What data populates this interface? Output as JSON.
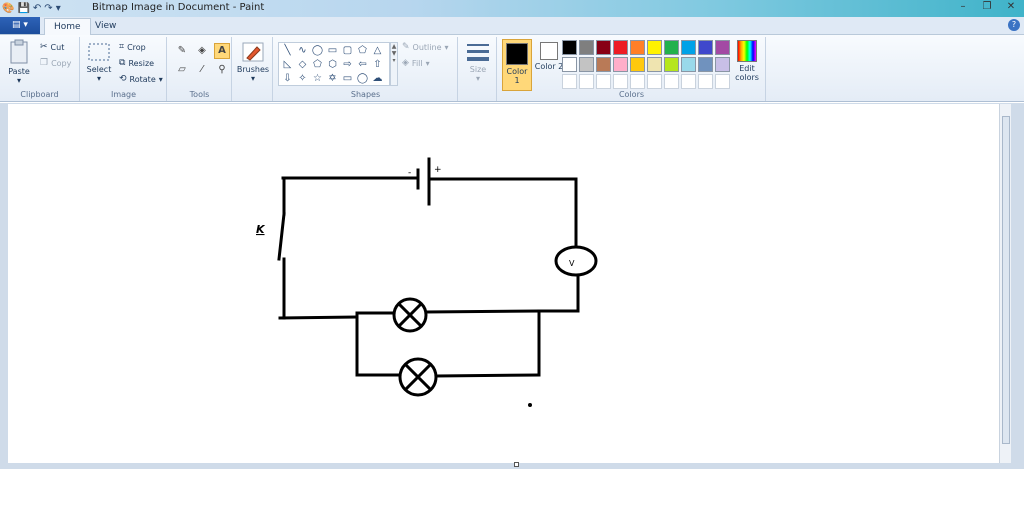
{
  "window": {
    "title": "Bitmap Image in Document - Paint",
    "controls": {
      "minimize": "–",
      "restore": "❐",
      "close": "✕"
    }
  },
  "qat": {
    "save": "💾",
    "undo": "↶",
    "redo": "↷",
    "customize": "▾"
  },
  "menu": {
    "app_button": "▤ ▾",
    "help": "?"
  },
  "tabs": [
    {
      "label": "Home",
      "active": true
    },
    {
      "label": "View",
      "active": false
    }
  ],
  "ribbon": {
    "clipboard": {
      "label": "Clipboard",
      "paste": "Paste",
      "cut": "Cut",
      "copy": "Copy"
    },
    "image": {
      "label": "Image",
      "select": "Select",
      "crop": "Crop",
      "resize": "Resize",
      "rotate": "Rotate"
    },
    "tools": {
      "label": "Tools"
    },
    "brushes": {
      "label": "Brushes"
    },
    "shapes": {
      "label": "Shapes",
      "outline": "Outline",
      "fill": "Fill"
    },
    "size": {
      "label": "Size"
    },
    "colors": {
      "label": "Colors",
      "color1": "Color 1",
      "color2": "Color 2",
      "edit": "Edit colors",
      "color1_value": "#000000",
      "color2_value": "#ffffff",
      "palette_row1": [
        "#000000",
        "#7f7f7f",
        "#880015",
        "#ed1c24",
        "#ff7f27",
        "#fff200",
        "#22b14c",
        "#00a2e8",
        "#3f48cc",
        "#a349a4"
      ],
      "palette_row2": [
        "#ffffff",
        "#c3c3c3",
        "#b97a57",
        "#ffaec9",
        "#ffc90e",
        "#efe4b0",
        "#b5e61d",
        "#99d9ea",
        "#7092be",
        "#c8bfe7"
      ]
    }
  },
  "drawing": {
    "switch_label": "K",
    "battery_marks": {
      "negative": "-",
      "positive": "+"
    },
    "voltmeter_label": "V"
  }
}
